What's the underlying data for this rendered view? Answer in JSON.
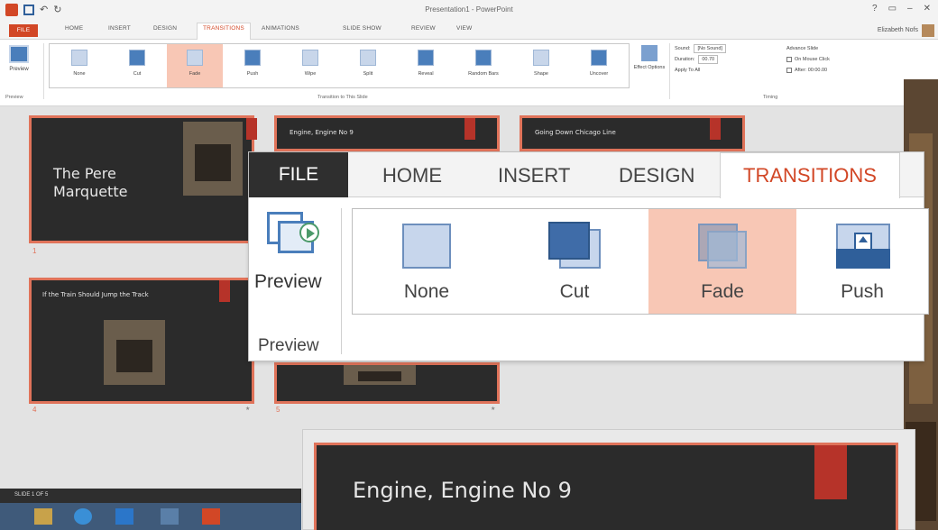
{
  "app": {
    "title": "Presentation1 - PowerPoint",
    "user": "Elizabeth Nofs",
    "window_controls": [
      "?",
      "▭",
      "–",
      "✕"
    ]
  },
  "qat": {
    "undo": "↶",
    "redo": "↻"
  },
  "small_tabs": [
    "FILE",
    "HOME",
    "INSERT",
    "DESIGN",
    "TRANSITIONS",
    "ANIMATIONS",
    "SLIDE SHOW",
    "REVIEW",
    "VIEW"
  ],
  "ribbon_small": {
    "preview": "Preview",
    "preview_group": "Preview",
    "transitions": [
      "None",
      "Cut",
      "Fade",
      "Push",
      "Wipe",
      "Split",
      "Reveal",
      "Random Bars",
      "Shape",
      "Uncover"
    ],
    "selected": "Fade",
    "group_label": "Transition to This Slide",
    "effect_options": "Effect Options",
    "sound_label": "Sound:",
    "sound_value": "[No Sound]",
    "duration_label": "Duration:",
    "duration_value": "00.70",
    "apply_all": "Apply To All",
    "advance_title": "Advance Slide",
    "on_click": "On Mouse Click",
    "after_label": "After:",
    "after_value": "00:00.00",
    "timing_group": "Timing"
  },
  "slides": [
    {
      "num": "1",
      "title": "The Pere Marquette"
    },
    {
      "num": "",
      "title": "Engine, Engine No 9"
    },
    {
      "num": "",
      "title": "Going Down Chicago Line"
    },
    {
      "num": "4",
      "title": "If the Train Should Jump the Track"
    },
    {
      "num": "5",
      "title": ""
    }
  ],
  "status": {
    "slide_count": "SLIDE 1 OF 5"
  },
  "zoom": {
    "tabs": [
      "FILE",
      "HOME",
      "INSERT",
      "DESIGN",
      "TRANSITIONS"
    ],
    "preview_label": "Preview",
    "preview_group": "Preview",
    "items": [
      "None",
      "Cut",
      "Fade",
      "Push"
    ]
  },
  "zoom_slide": {
    "title": "Engine, Engine No 9"
  },
  "colors": {
    "accent": "#d24726",
    "selection": "#f8c7b5",
    "slide_bg": "#2b2b2b",
    "slide_border": "#e0735a",
    "slide_red": "#b63329"
  }
}
